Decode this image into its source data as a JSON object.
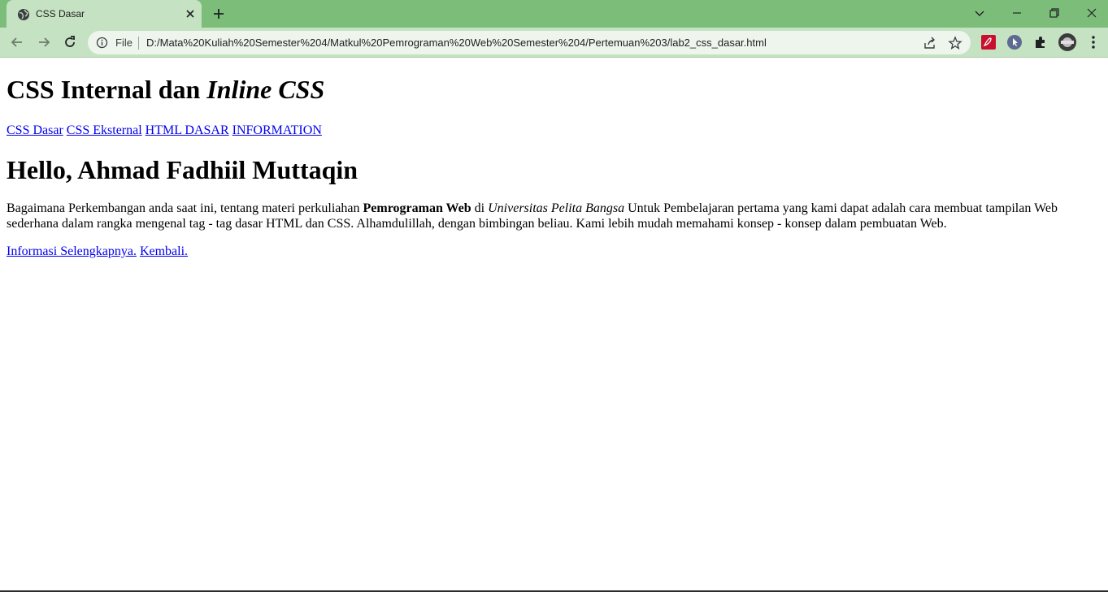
{
  "browser": {
    "tab_title": "CSS Dasar",
    "omnibox_scheme_label": "File",
    "url": "D:/Mata%20Kuliah%20Semester%204/Matkul%20Pemrograman%20Web%20Semester%204/Pertemuan%203/lab2_css_dasar.html",
    "icons": {
      "favicon": "globe-icon",
      "tab_close": "close-icon",
      "new_tab": "plus-icon",
      "back": "arrow-left-icon",
      "forward": "arrow-right-icon",
      "reload": "reload-icon",
      "info": "info-icon",
      "share": "share-icon",
      "bookmark": "star-icon",
      "extensions": "puzzle-icon",
      "menu": "kebab-menu-icon"
    },
    "colors": {
      "frame": "#7dbd7a",
      "toolbar": "#c5e2c2"
    }
  },
  "page": {
    "heading": {
      "part1": "CSS Internal dan ",
      "part2_italic": "Inline CSS"
    },
    "nav_links": [
      "CSS Dasar",
      "CSS Eksternal",
      "HTML DASAR",
      "INFORMATION"
    ],
    "greeting": "Hello, Ahmad Fadhiil Muttaqin",
    "paragraph": {
      "t1": "Bagaimana Perkembangan anda saat ini, tentang materi perkuliahan ",
      "bold": "Pemrograman Web",
      "t2": " di ",
      "italic": "Universitas Pelita Bangsa",
      "t3": " Untuk Pembelajaran pertama yang kami dapat adalah cara membuat tampilan Web sederhana dalam rangka mengenal tag - tag dasar HTML dan CSS. Alhamdulillah, dengan bimbingan beliau. Kami lebih mudah memahami konsep - konsep dalam pembuatan Web."
    },
    "footer_links": [
      "Informasi Selengkapnya.",
      "Kembali."
    ],
    "link_color": "#0000ee"
  }
}
